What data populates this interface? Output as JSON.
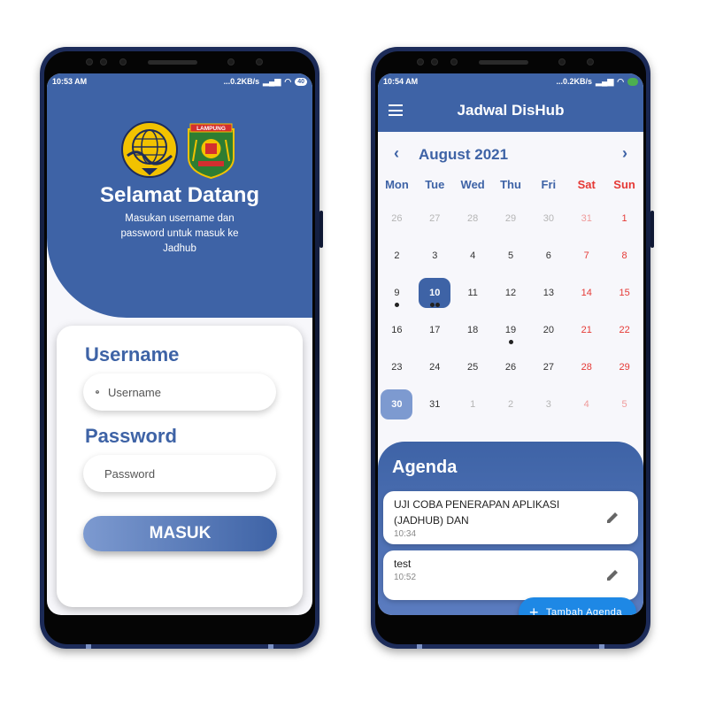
{
  "login_screen": {
    "status": {
      "time": "10:53 AM",
      "speed": "...0.2KB/s",
      "battery": "40"
    },
    "welcome_title": "Selamat Datang",
    "welcome_subtitle": "Masukan username dan password untuk masuk ke Jadhub",
    "logo_text": "LAMPUNG",
    "username": {
      "label": "Username",
      "placeholder": "Username"
    },
    "password": {
      "label": "Password",
      "placeholder": "Password"
    },
    "submit_label": "MASUK"
  },
  "schedule_screen": {
    "status": {
      "time": "10:54 AM",
      "speed": "...0.2KB/s"
    },
    "app_title": "Jadwal DisHub",
    "month_label": "August 2021",
    "prev_symbol": "‹",
    "next_symbol": "›",
    "weekdays": [
      "Mon",
      "Tue",
      "Wed",
      "Thu",
      "Fri",
      "Sat",
      "Sun"
    ],
    "days": [
      {
        "n": "26",
        "other": true
      },
      {
        "n": "27",
        "other": true
      },
      {
        "n": "28",
        "other": true
      },
      {
        "n": "29",
        "other": true
      },
      {
        "n": "30",
        "other": true
      },
      {
        "n": "31",
        "other": true
      },
      {
        "n": "1"
      },
      {
        "n": "2"
      },
      {
        "n": "3"
      },
      {
        "n": "4"
      },
      {
        "n": "5"
      },
      {
        "n": "6"
      },
      {
        "n": "7"
      },
      {
        "n": "8"
      },
      {
        "n": "9",
        "events": 1
      },
      {
        "n": "10",
        "selected": true,
        "events": 2
      },
      {
        "n": "11"
      },
      {
        "n": "12"
      },
      {
        "n": "13"
      },
      {
        "n": "14"
      },
      {
        "n": "15"
      },
      {
        "n": "16"
      },
      {
        "n": "17"
      },
      {
        "n": "18"
      },
      {
        "n": "19",
        "events": 1
      },
      {
        "n": "20"
      },
      {
        "n": "21"
      },
      {
        "n": "22"
      },
      {
        "n": "23"
      },
      {
        "n": "24"
      },
      {
        "n": "25"
      },
      {
        "n": "26"
      },
      {
        "n": "27"
      },
      {
        "n": "28"
      },
      {
        "n": "29"
      },
      {
        "n": "30",
        "today": true
      },
      {
        "n": "31"
      },
      {
        "n": "1",
        "other": true
      },
      {
        "n": "2",
        "other": true
      },
      {
        "n": "3",
        "other": true
      },
      {
        "n": "4",
        "other": true
      },
      {
        "n": "5",
        "other": true
      }
    ],
    "agenda_title": "Agenda",
    "agenda_items": [
      {
        "title": "UJI COBA PENERAPAN APLIKASI (JADHUB) DAN",
        "time": "10:34"
      },
      {
        "title": "test",
        "time": "10:52"
      }
    ],
    "add_button_label": "Tambah Agenda"
  },
  "colors": {
    "primary": "#3e63a6",
    "accent": "#1e88e5",
    "weekend": "#e53935"
  }
}
